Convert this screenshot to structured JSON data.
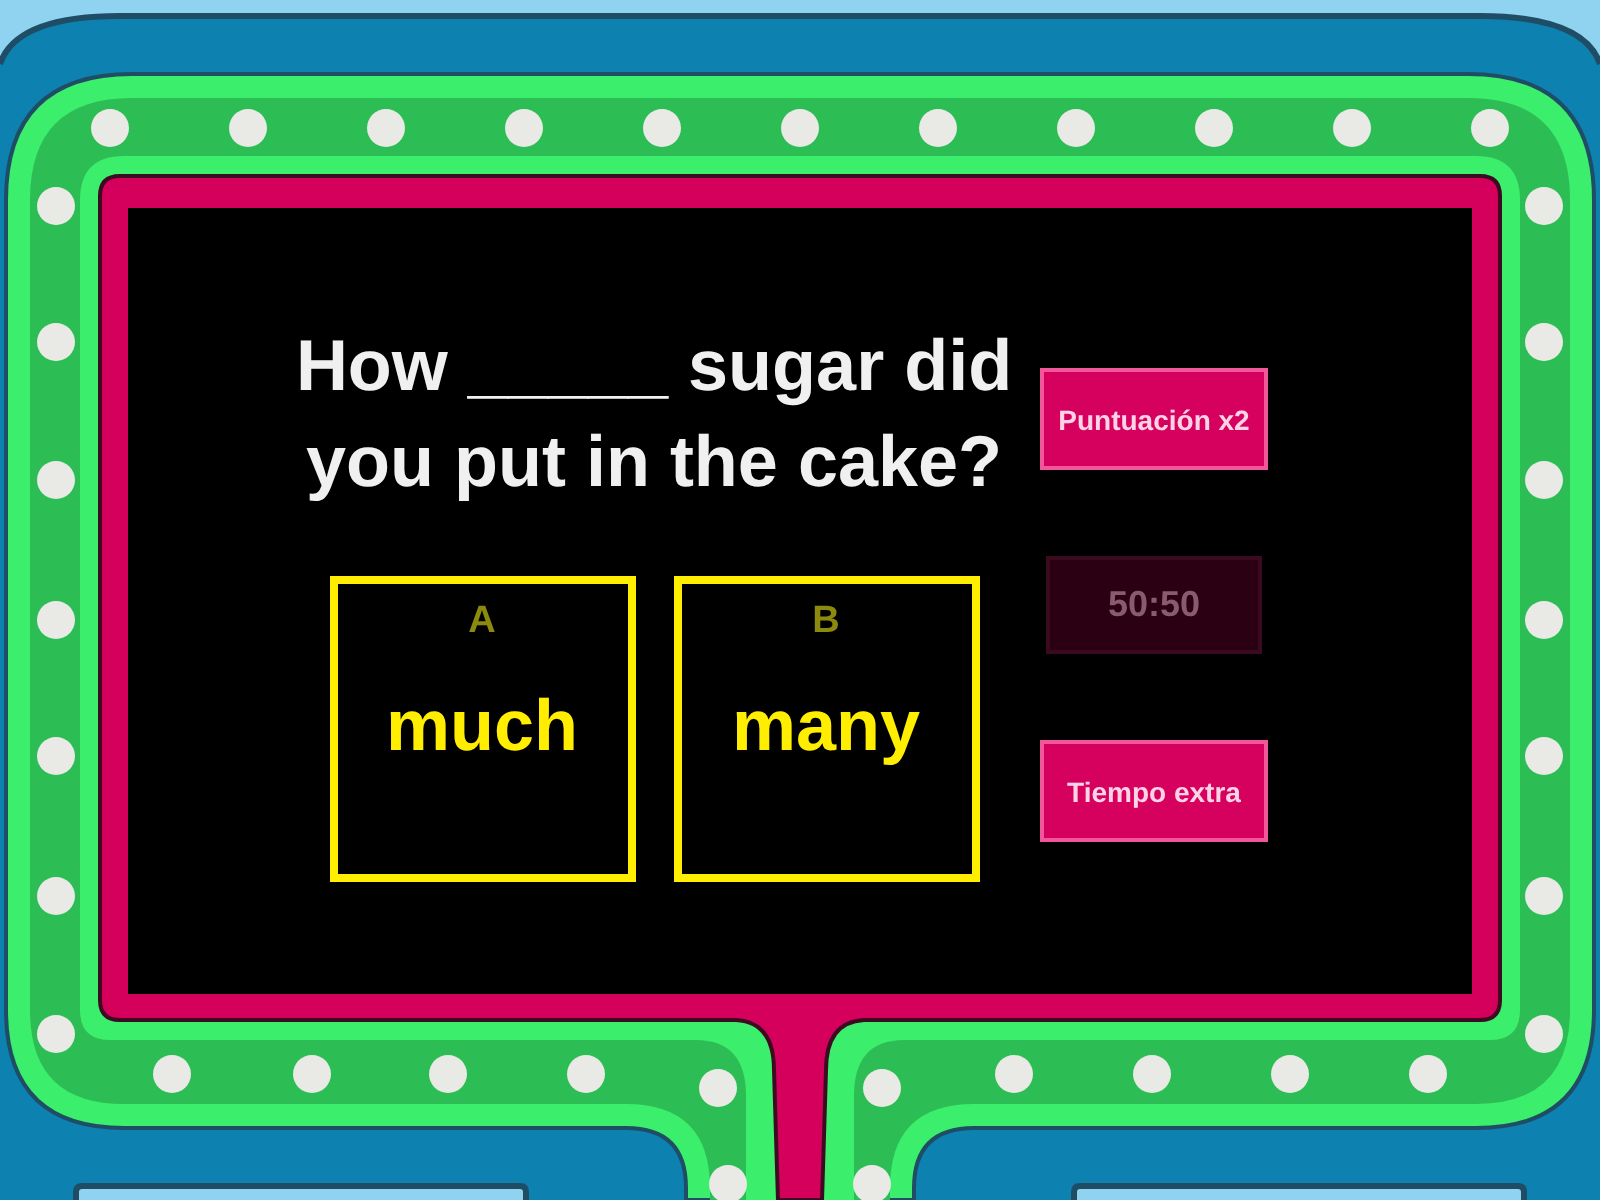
{
  "question": {
    "text": "How _____ sugar did you put in the cake?"
  },
  "answers": [
    {
      "letter": "A",
      "text": "much"
    },
    {
      "letter": "B",
      "text": "many"
    }
  ],
  "power_ups": [
    {
      "label": "Puntuación x2",
      "disabled": false
    },
    {
      "label": "50:50",
      "disabled": true
    },
    {
      "label": "Tiempo extra",
      "disabled": false
    }
  ]
}
